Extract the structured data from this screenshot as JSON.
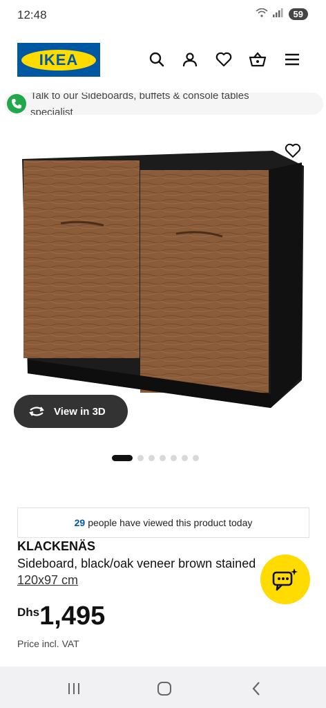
{
  "status": {
    "time": "12:48",
    "battery": "59"
  },
  "header": {
    "logo_text": "IKEA"
  },
  "chat_banner": {
    "text": "Talk to our Sideboards, buffets & console tables specialist"
  },
  "product": {
    "name": "KLACKENÄS",
    "description": "Sideboard, black/oak veneer brown stained",
    "size": "120x97 cm",
    "currency": "Dhs",
    "price": "1,495",
    "vat_note": "Price incl. VAT"
  },
  "gallery": {
    "view3d_label": "View in 3D",
    "dot_count": 7,
    "active_dot": 0
  },
  "viewed": {
    "count": "29",
    "text": "people have viewed this product today"
  },
  "colors": {
    "ikea_blue": "#0058a3",
    "ikea_yellow": "#ffdb00",
    "chat_green": "#20a84a"
  }
}
